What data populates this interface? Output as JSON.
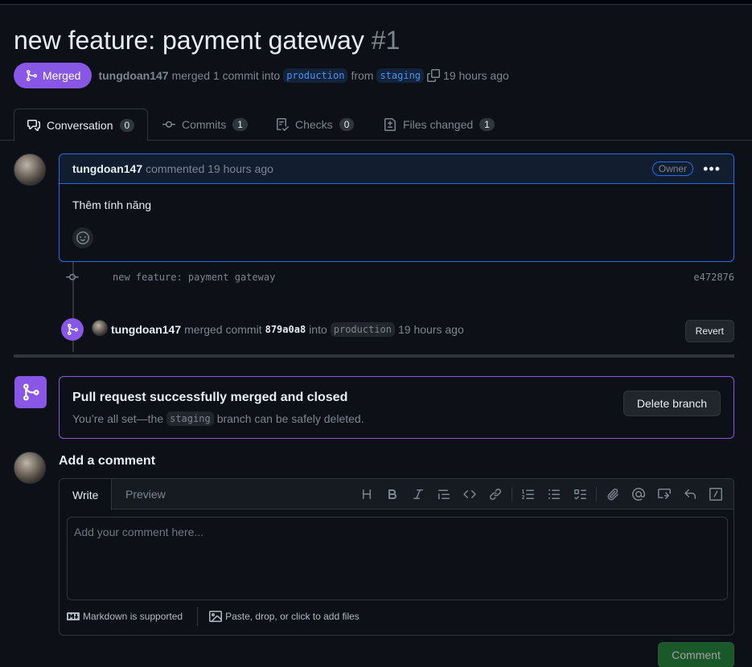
{
  "pr": {
    "title": "new feature: payment gateway",
    "number": "#1",
    "state_label": "Merged",
    "author": "tungdoan147",
    "merged_text": "merged 1 commit into",
    "base_branch": "production",
    "from_text": "from",
    "head_branch": "staging",
    "time": "19 hours ago"
  },
  "tabs": [
    {
      "label": "Conversation",
      "count": "0",
      "icon": "comment-discussion-icon"
    },
    {
      "label": "Commits",
      "count": "1",
      "icon": "git-commit-icon"
    },
    {
      "label": "Checks",
      "count": "0",
      "icon": "checklist-icon"
    },
    {
      "label": "Files changed",
      "count": "1",
      "icon": "file-diff-icon"
    }
  ],
  "comment": {
    "author": "tungdoan147",
    "action": "commented 19 hours ago",
    "badge": "Owner",
    "body": "Thêm tính năng"
  },
  "commit": {
    "message": "new feature: payment gateway",
    "sha": "e472876"
  },
  "merge_event": {
    "author": "tungdoan147",
    "text": "merged commit",
    "sha": "879a0a8",
    "into_text": "into",
    "branch": "production",
    "time": "19 hours ago",
    "revert_label": "Revert"
  },
  "merged_box": {
    "title": "Pull request successfully merged and closed",
    "sub_prefix": "You’re all set—the",
    "branch": "staging",
    "sub_suffix": "branch can be safely deleted.",
    "delete_label": "Delete branch"
  },
  "editor": {
    "heading": "Add a comment",
    "write_tab": "Write",
    "preview_tab": "Preview",
    "placeholder": "Add your comment here...",
    "markdown_note": "Markdown is supported",
    "files_note": "Paste, drop, or click to add files",
    "submit_label": "Comment",
    "toolbar": [
      "heading-icon",
      "bold-icon",
      "italic-icon",
      "quote-icon",
      "code-icon",
      "link-icon",
      "ordered-list-icon",
      "unordered-list-icon",
      "task-list-icon",
      "attach-icon",
      "mention-icon",
      "reference-icon",
      "reply-icon",
      "slash-command-icon"
    ]
  },
  "colors": {
    "background": "#0d1117",
    "merged_purple": "#8957e5",
    "accent_blue": "#1f6feb",
    "green_button": "#238636"
  }
}
